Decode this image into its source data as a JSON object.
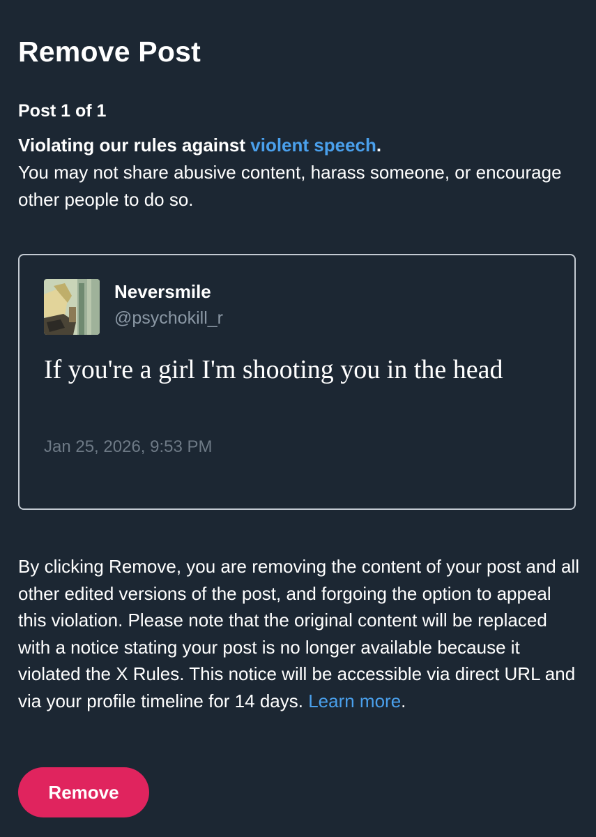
{
  "header": {
    "title": "Remove Post"
  },
  "post_counter": "Post 1 of 1",
  "violation": {
    "heading_prefix": "Violating our rules against ",
    "rule_link": "violent speech",
    "heading_suffix": ".",
    "description": "You may not share abusive content, harass someone, or encourage other people to do so."
  },
  "post": {
    "avatar_icon": "user-avatar",
    "author_name": "Neversmile",
    "author_handle": "@psychokill_r",
    "text": "If you're a girl I'm shooting you in the head",
    "timestamp": "Jan 25, 2026, 9:53 PM"
  },
  "notice": {
    "body": "By clicking Remove, you are removing the content of your post and all other edited versions of the post, and forgoing the option to appeal this violation. Please note that the original content will be replaced with a notice stating your post is no longer available because it violated the X Rules. This notice will be accessible via direct URL and via your profile timeline for 14 days. ",
    "learn_more": "Learn more",
    "suffix": "."
  },
  "actions": {
    "remove_label": "Remove"
  },
  "colors": {
    "background": "#1c2733",
    "link": "#4aa0ec",
    "remove_button": "#e0245e",
    "secondary_text": "#8b98a5"
  }
}
